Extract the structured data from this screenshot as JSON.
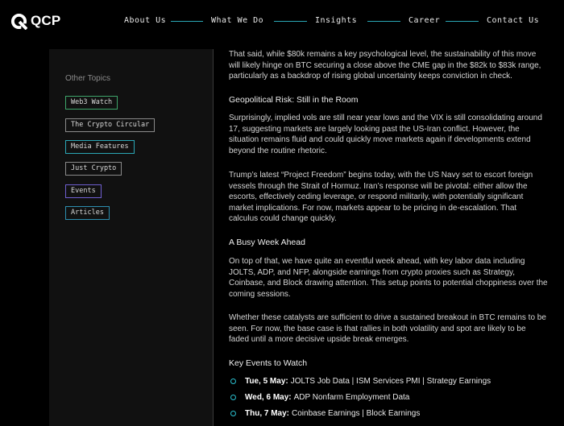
{
  "brand": {
    "name": "QCP"
  },
  "nav": {
    "items": [
      "About Us",
      "What We Do",
      "Insights",
      "Career",
      "Contact Us"
    ]
  },
  "colors": {
    "accent": "#2ba7b6",
    "background": "#000000",
    "sidebar": "#111111"
  },
  "sidebar": {
    "title": "Other Topics",
    "tags": [
      {
        "label": "Web3 Watch",
        "color": "#3ea66a"
      },
      {
        "label": "The Crypto Circular",
        "color": "#8a8a8a"
      },
      {
        "label": "Media Features",
        "color": "#2ba7b6"
      },
      {
        "label": "Just Crypto",
        "color": "#8a8a8a"
      },
      {
        "label": "Events",
        "color": "#6f5fd0"
      },
      {
        "label": "Articles",
        "color": "#2d8fb0"
      }
    ]
  },
  "article": {
    "p1": "That said, while $80k remains a key psychological level, the sustainability of this move will likely hinge on BTC securing a close above the CME gap in the $82k to $83k range, particularly as a backdrop of rising global uncertainty keeps conviction in check.",
    "h1": "Geopolitical Risk: Still in the Room",
    "p2": "Surprisingly, implied vols are still near year lows and the VIX is still consolidating around 17, suggesting markets are largely looking past the US-Iran conflict. However, the situation remains fluid and could quickly move markets again if developments extend beyond the routine rhetoric.",
    "p3": "Trump’s latest “Project Freedom” begins today, with the US Navy set to escort foreign vessels through the Strait of Hormuz. Iran’s response will be pivotal: either allow the escorts, effectively ceding leverage, or respond militarily, with potentially significant market implications. For now, markets appear to be pricing in de-escalation. That calculus could change quickly.",
    "h2": "A Busy Week Ahead",
    "p4": "On top of that, we have quite an eventful week ahead, with key labor data including JOLTS, ADP, and NFP, alongside earnings from crypto proxies such as Strategy, Coinbase, and Block drawing attention. This setup points to potential choppiness over the coming sessions.",
    "p5": "Whether these catalysts are sufficient to drive a sustained breakout in BTC remains to be seen. For now, the base case is that rallies in both volatility and spot are likely to be faded until a more decisive upside break emerges.",
    "h3": "Key Events to Watch",
    "events": [
      {
        "date": "Tue, 5 May:",
        "text": "JOLTS Job Data | ISM Services PMI | Strategy Earnings"
      },
      {
        "date": "Wed, 6 May:",
        "text": "ADP Nonfarm Employment Data"
      },
      {
        "date": "Thu, 7 May:",
        "text": "Coinbase Earnings | Block Earnings"
      }
    ]
  }
}
